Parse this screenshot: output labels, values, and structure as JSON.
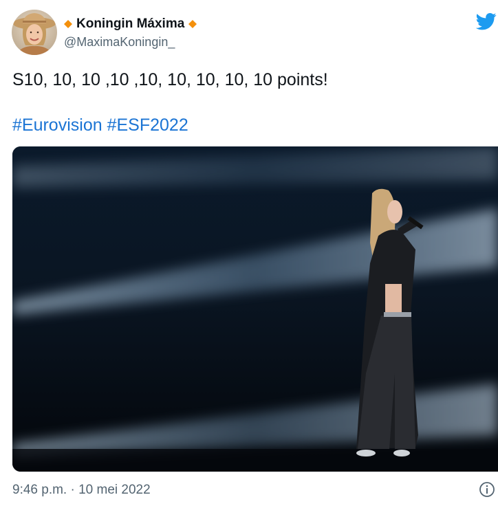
{
  "author": {
    "display_name": "Koningin Máxima",
    "handle": "@MaximaKoningin_",
    "avatar_icon": "profile-photo-avatar",
    "badge_icon": "orange-diamond-icon",
    "badge_color": "#f4900c"
  },
  "brand": {
    "icon": "twitter-bird-icon",
    "color": "#1d9bf0"
  },
  "tweet": {
    "text": "S10, 10, 10 ,10 ,10, 10, 10, 10, 10 points!",
    "hashtags": [
      "#Eurovision",
      "#ESF2022"
    ],
    "hashtag_color": "#1b74d4",
    "media": {
      "type": "photo",
      "icon": "stage-performance-photo"
    },
    "timestamp": "9:46 p.m. · 10 mei 2022",
    "info_icon": "info-icon"
  }
}
